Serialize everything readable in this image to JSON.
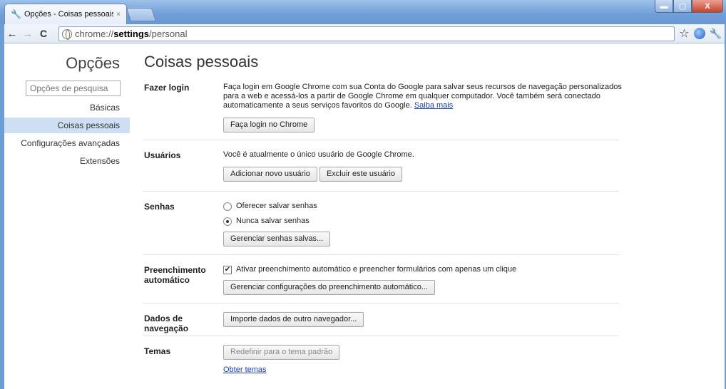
{
  "window": {
    "tab_title": "Opções - Coisas pessoais",
    "tab_close": "×",
    "min_glyph": "▬",
    "max_glyph": "▢",
    "close_glyph": "X"
  },
  "toolbar": {
    "back_glyph": "←",
    "forward_glyph": "→",
    "reload_glyph": "C",
    "url_scheme": "chrome://",
    "url_host": "settings",
    "url_path": "/personal",
    "star_glyph": "☆",
    "wrench_glyph": "🔧"
  },
  "sidebar": {
    "title": "Opções",
    "search_placeholder": "Opções de pesquisa",
    "items": [
      {
        "label": "Básicas"
      },
      {
        "label": "Coisas pessoais"
      },
      {
        "label": "Configurações avançadas"
      },
      {
        "label": "Extensões"
      }
    ]
  },
  "main": {
    "title": "Coisas pessoais",
    "login": {
      "label": "Fazer login",
      "text": "Faça login em Google Chrome com sua Conta do Google para salvar seus recursos de navegação personalizados para a web e acessá-los a partir de Google Chrome em qualquer computador. Você também será conectado automaticamente a seus serviços favoritos do Google.",
      "link": "Saiba mais",
      "button": "Faça login no Chrome"
    },
    "users": {
      "label": "Usuários",
      "text": "Você é atualmente o único usuário de Google Chrome.",
      "add_button": "Adicionar novo usuário",
      "delete_button": "Excluir este usuário"
    },
    "passwords": {
      "label": "Senhas",
      "option_offer": "Oferecer salvar senhas",
      "option_never": "Nunca salvar senhas",
      "selected": "never",
      "manage_button": "Gerenciar senhas salvas..."
    },
    "autofill": {
      "label": "Preenchimento automático",
      "checkbox_label": "Ativar preenchimento automático e preencher formulários com apenas um clique",
      "checked": true,
      "manage_button": "Gerenciar configurações do preenchimento automático..."
    },
    "browsing_data": {
      "label": "Dados de navegação",
      "import_button": "Importe dados de outro navegador..."
    },
    "themes": {
      "label": "Temas",
      "reset_button": "Redefinir para o tema padrão",
      "get_link": "Obter temas"
    }
  },
  "colors": {
    "frame_blue": "#6d9bd3",
    "selected_bg": "#cfdff3",
    "link": "#1a3fa8"
  }
}
